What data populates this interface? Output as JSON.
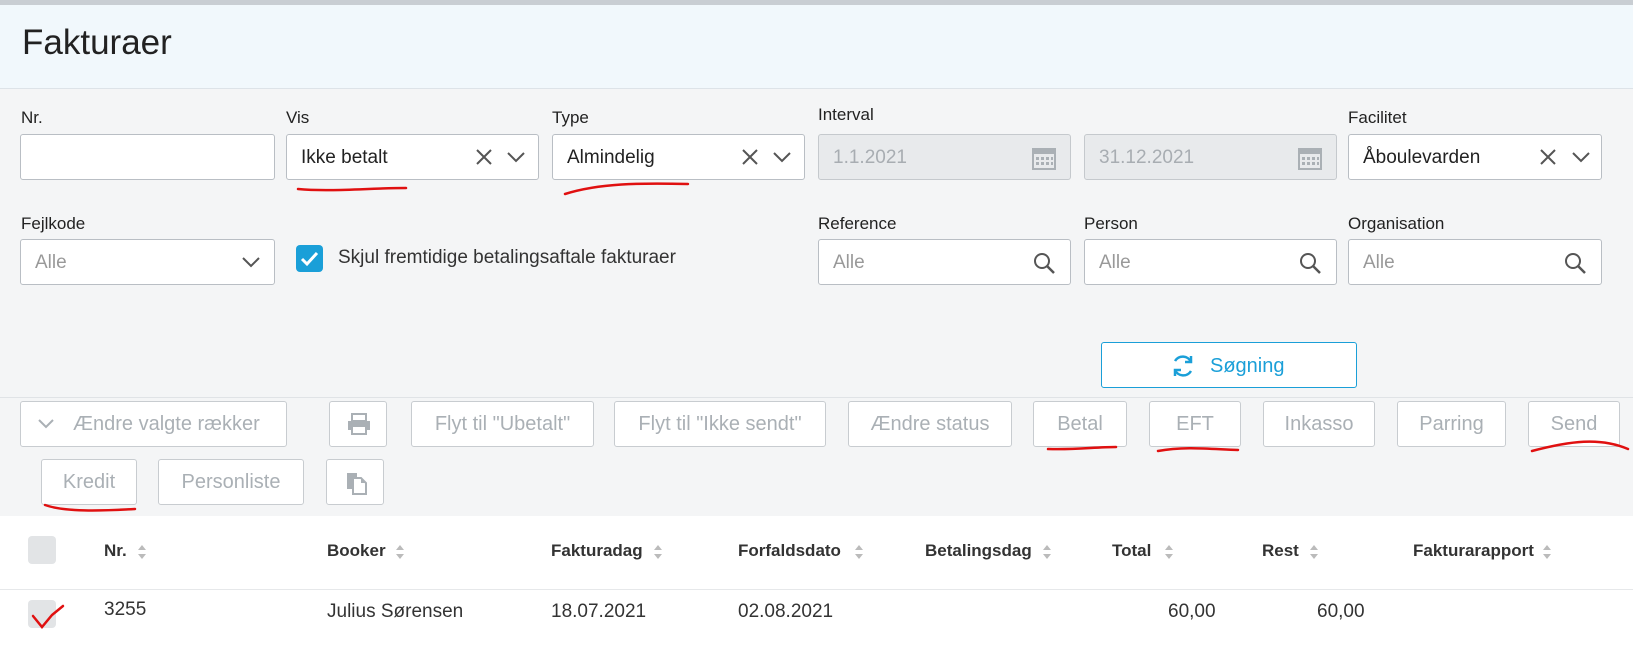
{
  "page": {
    "title": "Fakturaer"
  },
  "filters": {
    "nr": {
      "label": "Nr.",
      "value": ""
    },
    "vis": {
      "label": "Vis",
      "value": "Ikke betalt"
    },
    "type": {
      "label": "Type",
      "value": "Almindelig"
    },
    "interval": {
      "label": "Interval",
      "from": "1.1.2021",
      "to": "31.12.2021",
      "separator": "–"
    },
    "facilitet": {
      "label": "Facilitet",
      "value": "Åboulevarden"
    },
    "fejlkode": {
      "label": "Fejlkode",
      "placeholder": "Alle"
    },
    "hide_future": {
      "label": "Skjul fremtidige betalingsaftale fakturaer",
      "checked": true
    },
    "reference": {
      "label": "Reference",
      "placeholder": "Alle"
    },
    "person": {
      "label": "Person",
      "placeholder": "Alle"
    },
    "organisation": {
      "label": "Organisation",
      "placeholder": "Alle"
    },
    "search_label": "Søgning"
  },
  "toolbar": {
    "change_rows": "Ændre valgte rækker",
    "move_unpaid": "Flyt til \"Ubetalt\"",
    "move_not_sent": "Flyt til \"Ikke sendt\"",
    "change_status": "Ændre status",
    "pay": "Betal",
    "eft": "EFT",
    "collection": "Inkasso",
    "matching": "Parring",
    "send": "Send",
    "credit": "Kredit",
    "person_list": "Personliste"
  },
  "table": {
    "columns": [
      "Nr.",
      "Booker",
      "Fakturadag",
      "Forfaldsdato",
      "Betalingsdag",
      "Total",
      "Rest",
      "Fakturarapport"
    ],
    "rows": [
      {
        "nr": "3255",
        "booker": "Julius Sørensen",
        "fakturadag": "18.07.2021",
        "forfaldsdato": "02.08.2021",
        "betalingsdag": "",
        "total": "60,00",
        "rest": "60,00",
        "rapport": ""
      }
    ]
  },
  "colors": {
    "accent": "#1a9fd8",
    "annotation": "#e01010"
  },
  "icons": [
    "close-icon",
    "chevron-down-icon",
    "calendar-icon",
    "search-icon",
    "refresh-icon",
    "print-icon",
    "copy-icon",
    "sort-icon",
    "check-icon"
  ]
}
